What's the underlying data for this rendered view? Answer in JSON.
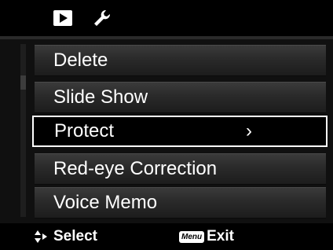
{
  "tabs": [
    {
      "icon": "playback-icon"
    },
    {
      "icon": "wrench-icon"
    }
  ],
  "menu": {
    "items": [
      {
        "label": "Delete",
        "selected": false
      },
      {
        "label": "Slide Show",
        "selected": false
      },
      {
        "label": "Protect",
        "selected": true,
        "arrow": "›"
      },
      {
        "label": "Red-eye Correction",
        "selected": false
      },
      {
        "label": "Voice Memo",
        "selected": false
      }
    ]
  },
  "footer": {
    "select_label": "Select",
    "menu_badge": "Menu",
    "exit_label": "Exit"
  },
  "colors": {
    "background": "#000000",
    "item_background": "#2a2a2a",
    "selected_border": "#ffffff",
    "text": "#ffffff"
  }
}
